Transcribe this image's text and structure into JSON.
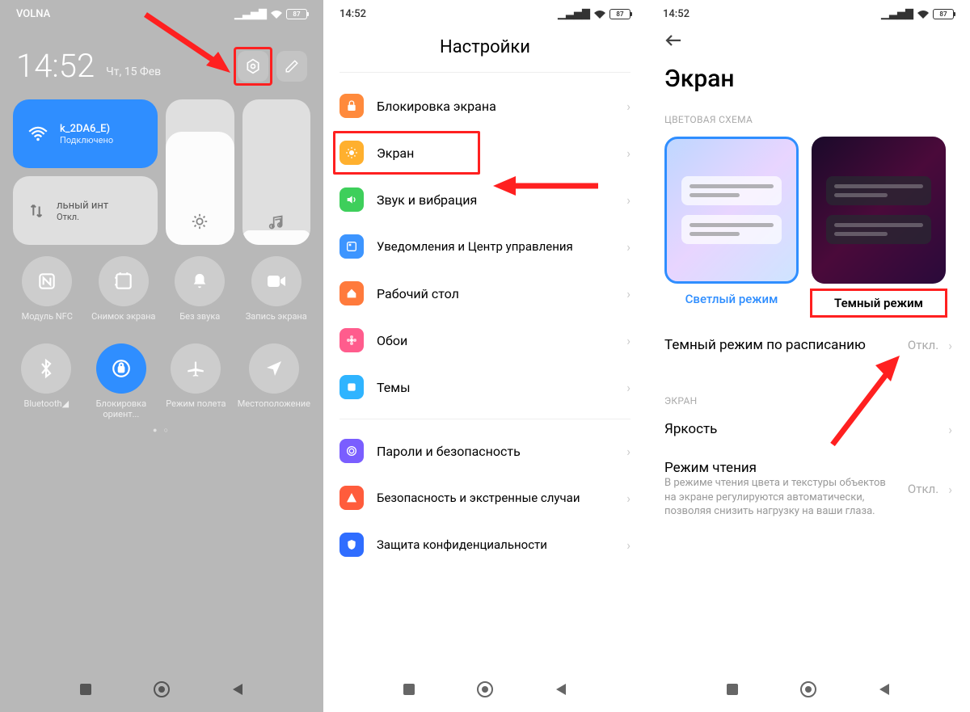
{
  "phone1": {
    "carrier": "VOLNA",
    "battery": "87",
    "time": "14:52",
    "date": "Чт, 15 Фев",
    "wifi_ssid": "k_2DA6_E)",
    "wifi_status": "Подключено",
    "data_label": "льный инт",
    "data_status": "Откл.",
    "qs": [
      {
        "label": "Модуль NFC"
      },
      {
        "label": "Снимок экрана"
      },
      {
        "label": "Без звука"
      },
      {
        "label": "Запись экрана"
      },
      {
        "label": "Bluetooth◢"
      },
      {
        "label": "Блокировка ориент..."
      },
      {
        "label": "Режим полета"
      },
      {
        "label": "Местоположение"
      }
    ]
  },
  "phone2": {
    "time": "14:52",
    "battery": "87",
    "title": "Настройки",
    "items": [
      {
        "label": "Блокировка экрана",
        "color": "ic-orange"
      },
      {
        "label": "Экран",
        "color": "ic-yellow",
        "highlight": true
      },
      {
        "label": "Звук и вибрация",
        "color": "ic-green"
      },
      {
        "label": "Уведомления и Центр управления",
        "color": "ic-blue",
        "multi": true
      },
      {
        "label": "Рабочий стол",
        "color": "ic-dorange"
      },
      {
        "label": "Обои",
        "color": "ic-pink"
      },
      {
        "label": "Темы",
        "color": "ic-cyan"
      },
      {
        "label": "Пароли и безопасность",
        "color": "ic-purple"
      },
      {
        "label": "Безопасность и экстренные случаи",
        "color": "ic-red",
        "multi": true
      },
      {
        "label": "Защита конфиденциальности",
        "color": "ic-dblue",
        "multi": true
      }
    ]
  },
  "phone3": {
    "time": "14:52",
    "battery": "87",
    "title": "Экран",
    "section_color": "ЦВЕТОВАЯ СХЕМА",
    "light_label": "Светлый режим",
    "dark_label": "Темный режим",
    "schedule_label": "Темный режим по расписанию",
    "schedule_val": "Откл.",
    "section_screen": "ЭКРАН",
    "brightness_label": "Яркость",
    "reading_label": "Режим чтения",
    "reading_desc": "В режиме чтения цвета и текстуры объектов на экране регулируются автоматически, позволяя снизить нагрузку на ваши глаза.",
    "reading_val": "Откл."
  }
}
